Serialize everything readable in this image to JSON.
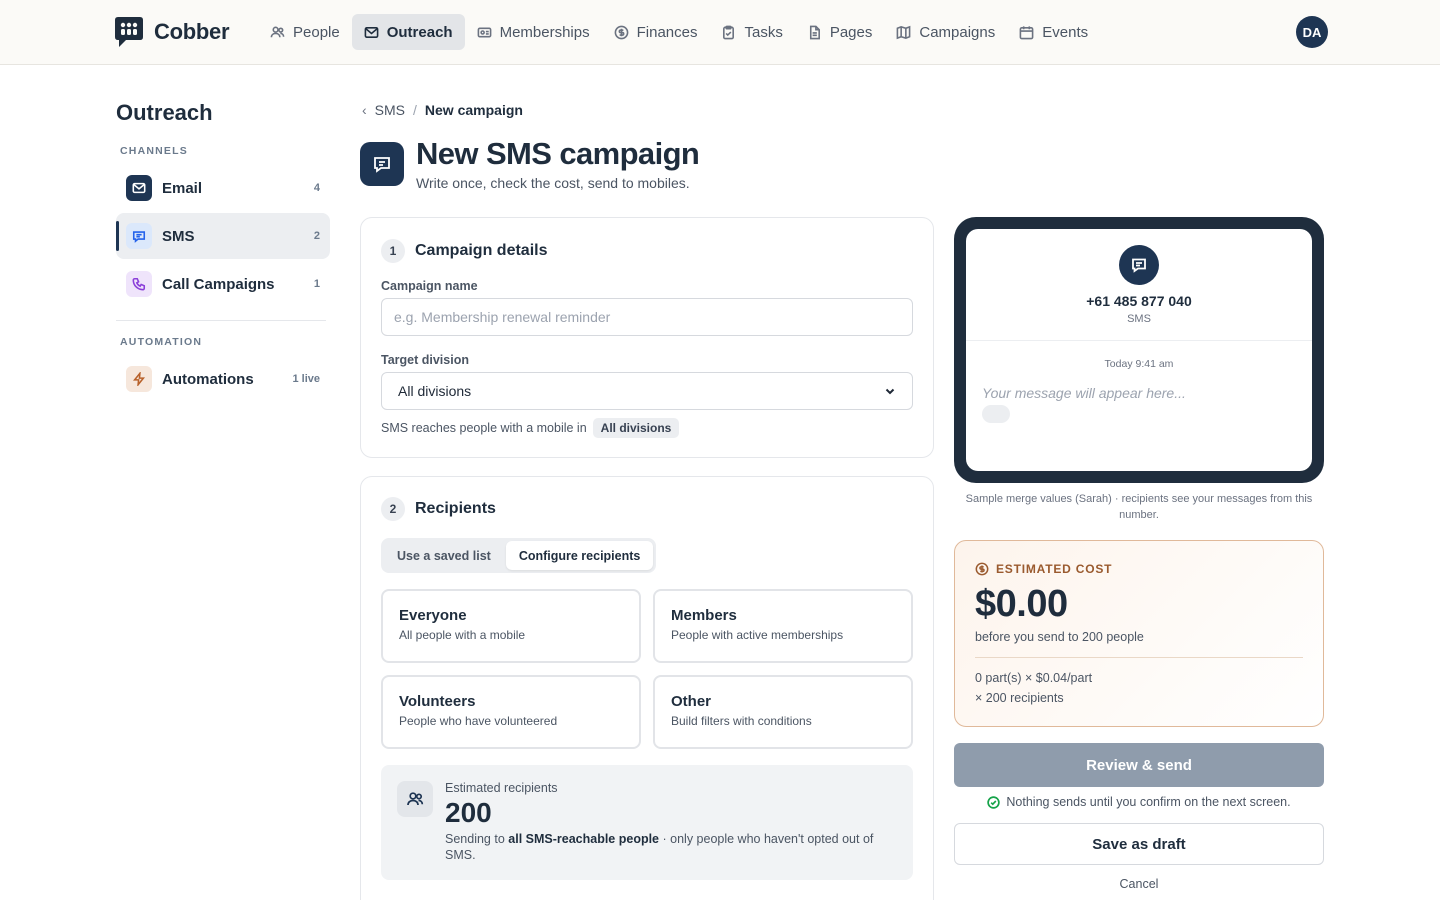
{
  "app": {
    "name": "Cobber",
    "user_initials": "DA"
  },
  "nav": [
    {
      "label": "People",
      "icon": "people-icon",
      "active": false
    },
    {
      "label": "Outreach",
      "icon": "mail-icon",
      "active": true
    },
    {
      "label": "Memberships",
      "icon": "card-icon",
      "active": false
    },
    {
      "label": "Finances",
      "icon": "dollar-icon",
      "active": false
    },
    {
      "label": "Tasks",
      "icon": "clipboard-icon",
      "active": false
    },
    {
      "label": "Pages",
      "icon": "file-icon",
      "active": false
    },
    {
      "label": "Campaigns",
      "icon": "map-icon",
      "active": false
    },
    {
      "label": "Events",
      "icon": "calendar-icon",
      "active": false
    }
  ],
  "sidebar": {
    "title": "Outreach",
    "channels_heading": "CHANNELS",
    "channels": [
      {
        "label": "Email",
        "count": "4",
        "icon": "mail-icon",
        "active": false
      },
      {
        "label": "SMS",
        "count": "2",
        "icon": "message-icon",
        "active": true
      },
      {
        "label": "Call Campaigns",
        "count": "1",
        "icon": "phone-icon",
        "active": false
      }
    ],
    "automation_heading": "AUTOMATION",
    "automation": [
      {
        "label": "Automations",
        "count": "1 live",
        "icon": "bolt-icon"
      }
    ]
  },
  "breadcrumb": {
    "parent": "SMS",
    "separator": "/",
    "current": "New campaign"
  },
  "header": {
    "title": "New SMS campaign",
    "subtitle": "Write once, check the cost, send to mobiles."
  },
  "details": {
    "step": "1",
    "title": "Campaign details",
    "name_label": "Campaign name",
    "name_placeholder": "e.g. Membership renewal reminder",
    "name_value": "",
    "division_label": "Target division",
    "division_value": "All divisions",
    "hint_prefix": "SMS reaches people with a mobile in",
    "hint_chip": "All divisions"
  },
  "recipients": {
    "step": "2",
    "title": "Recipients",
    "tabs": [
      {
        "label": "Use a saved list",
        "active": false
      },
      {
        "label": "Configure recipients",
        "active": true
      }
    ],
    "options": [
      {
        "title": "Everyone",
        "desc": "All people with a mobile"
      },
      {
        "title": "Members",
        "desc": "People with active memberships"
      },
      {
        "title": "Volunteers",
        "desc": "People who have volunteered"
      },
      {
        "title": "Other",
        "desc": "Build filters with conditions"
      }
    ],
    "estimate_label": "Estimated recipients",
    "estimate_value": "200",
    "estimate_desc_prefix": "Sending to",
    "estimate_desc_bold": "all SMS-reachable people",
    "estimate_desc_suffix": "· only people who haven't opted out of SMS."
  },
  "preview": {
    "number": "+61 485 877 040",
    "type": "SMS",
    "time": "Today 9:41 am",
    "placeholder": "Your message will appear here...",
    "note": "Sample merge values (Sarah) · recipients see your messages from this number."
  },
  "cost": {
    "label": "ESTIMATED COST",
    "amount": "$0.00",
    "sub": "before you send to 200 people",
    "line1": "0 part(s) × $0.04/part",
    "line2": "× 200 recipients"
  },
  "actions": {
    "review": "Review & send",
    "confirm_note": "Nothing sends until you confirm on the next screen.",
    "draft": "Save as draft",
    "cancel": "Cancel"
  },
  "colors": {
    "brand": "#1e3553",
    "cost_accent": "#9a5a2e",
    "disabled_button": "#8f9cac"
  }
}
